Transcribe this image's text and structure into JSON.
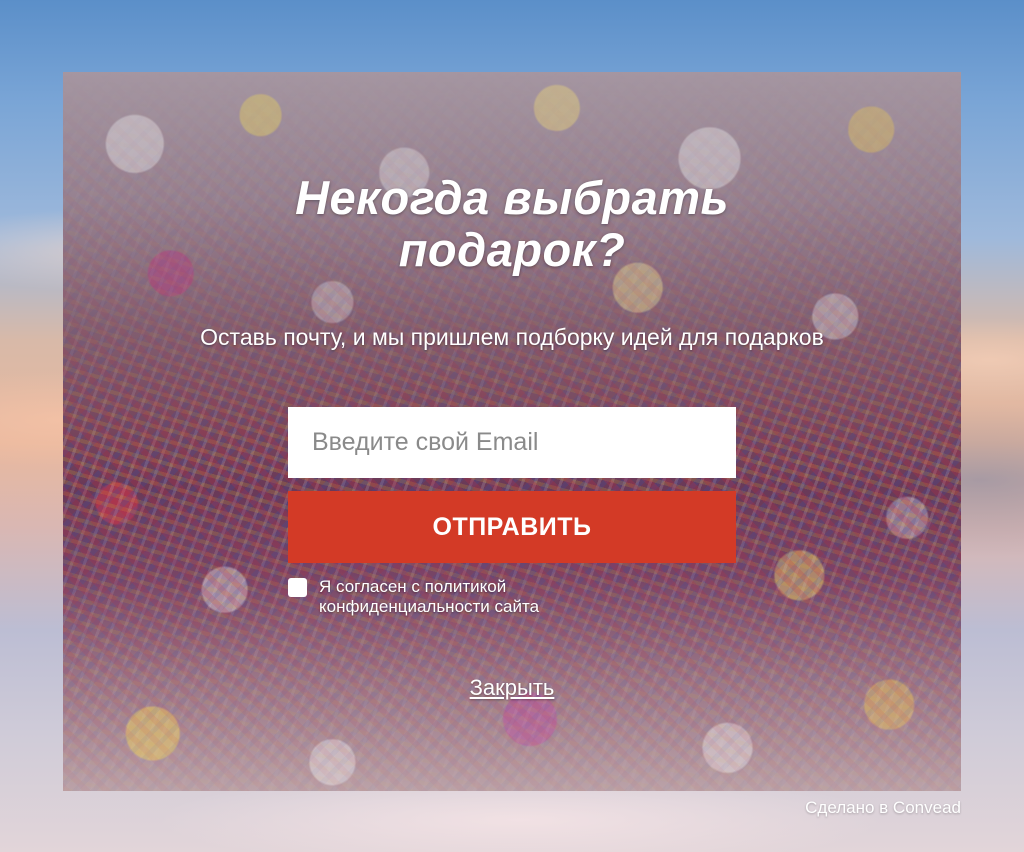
{
  "popup": {
    "title_line1": "Некогда выбрать",
    "title_line2": "подарок?",
    "subtitle": "Оставь почту, и мы пришлем подборку идей для подарков",
    "email": {
      "placeholder": "Введите свой Email",
      "value": ""
    },
    "submit_label": "ОТПРАВИТЬ",
    "consent": {
      "checked": false,
      "label": "Я согласен с политикой конфиденциальности сайта"
    },
    "close_label": "Закрыть"
  },
  "footer": {
    "credit": "Сделано в Convead"
  },
  "colors": {
    "submit_button": "#d33a26",
    "text": "#ffffff"
  }
}
